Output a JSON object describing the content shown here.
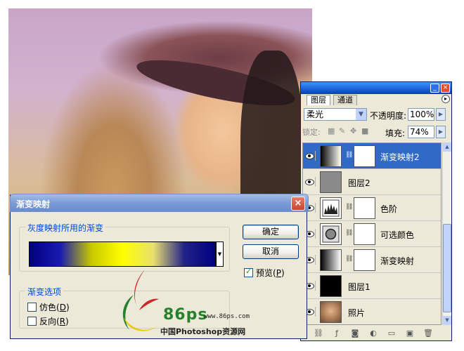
{
  "layers_panel": {
    "tabs": [
      "图层",
      "通道"
    ],
    "active_tab": "图层",
    "blend_mode": "柔光",
    "opacity_label": "不透明度:",
    "opacity": "100%",
    "lock_label": "锁定:",
    "fill_label": "填充:",
    "fill": "74%",
    "layers": [
      {
        "name": "渐变映射2",
        "thumb": "gradient",
        "mask": true,
        "visible": true,
        "selected": true
      },
      {
        "name": "图层2",
        "thumb": "gray",
        "mask": false,
        "visible": true,
        "selected": false
      },
      {
        "name": "色阶",
        "thumb": "levels-icon",
        "mask": true,
        "visible": true,
        "selected": false
      },
      {
        "name": "可选颜色",
        "thumb": "selective-color-icon",
        "mask": true,
        "visible": true,
        "selected": false
      },
      {
        "name": "渐变映射",
        "thumb": "gradient",
        "mask": true,
        "visible": true,
        "selected": false
      },
      {
        "name": "图层1",
        "thumb": "black",
        "mask": false,
        "visible": true,
        "selected": false
      },
      {
        "name": "照片",
        "thumb": "photo",
        "mask": false,
        "visible": true,
        "selected": false
      }
    ]
  },
  "gradient_map_dialog": {
    "title": "渐变映射",
    "gradient_group_label": "灰度映射所用的渐变",
    "gradient_colors": [
      "#000080",
      "#1a1ab0",
      "#c8c800",
      "#ffff00",
      "#e8e070",
      "#222288",
      "#000080"
    ],
    "options_group_label": "渐变选项",
    "dither_label": "仿色(",
    "dither_key": "D",
    "reverse_label": "反向(",
    "reverse_key": "R",
    "dither_checked": false,
    "reverse_checked": false,
    "ok_label": "确定",
    "cancel_label": "取消",
    "preview_label": "预览(",
    "preview_key": "P",
    "preview_checked": true
  },
  "watermark": {
    "brand": "86ps",
    "url": "www.86ps.com",
    "tagline": "中国Photoshop资源网"
  },
  "colors": {
    "selected_row": "#316ac5",
    "panel_bg": "#ece9d8",
    "dialog_titlebar": "#7c9cd8",
    "group_label": "#0046d5",
    "watermark_green": "#26802c",
    "watermark_red": "#c8262a"
  }
}
